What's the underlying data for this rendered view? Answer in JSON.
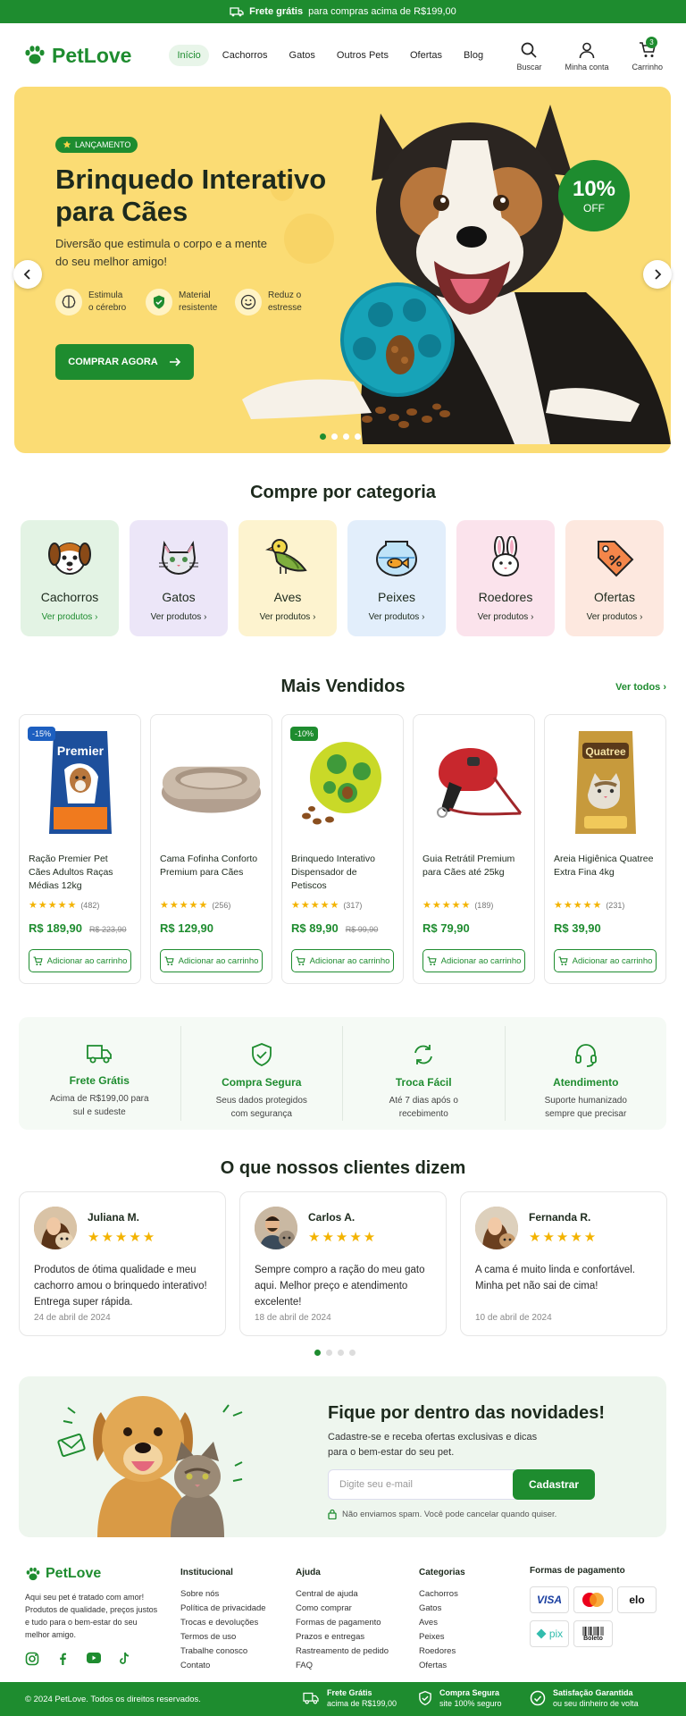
{
  "topbar": {
    "strong": "Frete grátis",
    "rest": "para compras acima de R$199,00"
  },
  "header": {
    "logo": "PetLove",
    "nav": [
      "Início",
      "Cachorros",
      "Gatos",
      "Outros Pets",
      "Ofertas",
      "Blog"
    ],
    "icons": {
      "search": "Buscar",
      "account": "Minha conta",
      "cart": "Carrinho",
      "cart_count": "3"
    }
  },
  "hero": {
    "badge": "LANÇAMENTO",
    "title": "Brinquedo Interativo para Cães",
    "subtitle": "Diversão que estimula o corpo e a mente do seu melhor amigo!",
    "features": [
      {
        "line1": "Estimula",
        "line2": "o cérebro",
        "icon": "brain-icon"
      },
      {
        "line1": "Material",
        "line2": "resistente",
        "icon": "shield-icon"
      },
      {
        "line1": "Reduz o",
        "line2": "estresse",
        "icon": "smile-icon"
      }
    ],
    "button": "COMPRAR AGORA",
    "discount_value": "10%",
    "discount_label": "OFF",
    "slides": 4,
    "active_slide": 1
  },
  "categories": {
    "title": "Compre por categoria",
    "items": [
      {
        "name": "Cachorros",
        "link": "Ver produtos ›",
        "bg": "#e3f3e4"
      },
      {
        "name": "Gatos",
        "link": "Ver produtos ›",
        "bg": "#ece6f8"
      },
      {
        "name": "Aves",
        "link": "Ver produtos ›",
        "bg": "#fdf3cf"
      },
      {
        "name": "Peixes",
        "link": "Ver produtos ›",
        "bg": "#e2eefb"
      },
      {
        "name": "Roedores",
        "link": "Ver produtos ›",
        "bg": "#fbe3ec"
      },
      {
        "name": "Ofertas",
        "link": "Ver produtos ›",
        "bg": "#fde8df"
      }
    ]
  },
  "bestsellers": {
    "title": "Mais Vendidos",
    "see_all": "Ver todos ›",
    "products": [
      {
        "name": "Ração Premier Pet Cães Adultos Raças Médias 12kg",
        "rating": 4.5,
        "reviews": "(482)",
        "price": "R$ 189,90",
        "old_price": "R$ 223,90",
        "tag": "-15%",
        "button": "Adicionar ao carrinho"
      },
      {
        "name": "Cama Fofinha Conforto Premium para Cães",
        "rating": 4.5,
        "reviews": "(256)",
        "price": "R$ 129,90",
        "old_price": "",
        "tag": "",
        "button": "Adicionar ao carrinho"
      },
      {
        "name": "Brinquedo Interativo Dispensador de Petiscos",
        "rating": 4.5,
        "reviews": "(317)",
        "price": "R$ 89,90",
        "old_price": "R$ 99,90",
        "tag": "-10%",
        "button": "Adicionar ao carrinho"
      },
      {
        "name": "Guia Retrátil Premium para Cães até 25kg",
        "rating": 4.5,
        "reviews": "(189)",
        "price": "R$ 79,90",
        "old_price": "",
        "tag": "",
        "button": "Adicionar ao carrinho"
      },
      {
        "name": "Areia Higiênica Quatree Extra Fina 4kg",
        "rating": 4.5,
        "reviews": "(231)",
        "price": "R$ 39,90",
        "old_price": "",
        "tag": "",
        "button": "Adicionar ao carrinho"
      }
    ],
    "package_texts": {
      "premier": "Premier",
      "quatree": "Quatree"
    }
  },
  "benefits": [
    {
      "title": "Frete Grátis",
      "desc": "Acima de R$199,00 para sul e sudeste",
      "icon": "truck-icon"
    },
    {
      "title": "Compra Segura",
      "desc": "Seus dados protegidos com segurança",
      "icon": "shield-check-icon"
    },
    {
      "title": "Troca Fácil",
      "desc": "Até 7 dias após o recebimento",
      "icon": "refresh-icon"
    },
    {
      "title": "Atendimento",
      "desc": "Suporte humanizado sempre que precisar",
      "icon": "headset-icon"
    }
  ],
  "testimonials": {
    "title": "O que nossos clientes dizem",
    "items": [
      {
        "name": "Juliana M.",
        "stars": 5,
        "text": "Produtos de ótima qualidade e meu cachorro amou o brinquedo interativo! Entrega super rápida.",
        "date": "24 de abril de 2024"
      },
      {
        "name": "Carlos A.",
        "stars": 5,
        "text": "Sempre compro a ração do meu gato aqui. Melhor preço e atendimento excelente!",
        "date": "18 de abril de 2024"
      },
      {
        "name": "Fernanda R.",
        "stars": 5,
        "text": "A cama é muito linda e confortável. Minha pet não sai de cima!",
        "date": "10 de abril de 2024"
      }
    ]
  },
  "newsletter": {
    "title": "Fique por dentro das novidades!",
    "subtitle": "Cadastre-se e receba ofertas exclusivas e dicas para o bem-estar do seu pet.",
    "placeholder": "Digite seu e-mail",
    "button": "Cadastrar",
    "note": "Não enviamos spam. Você pode cancelar quando quiser."
  },
  "footer": {
    "brand": "PetLove",
    "about": "Aqui seu pet é tratado com amor! Produtos de qualidade, preços justos e tudo para o bem-estar do seu melhor amigo.",
    "columns": [
      {
        "title": "Institucional",
        "links": [
          "Sobre nós",
          "Política de privacidade",
          "Trocas e devoluções",
          "Termos de uso",
          "Trabalhe conosco",
          "Contato"
        ]
      },
      {
        "title": "Ajuda",
        "links": [
          "Central de ajuda",
          "Como comprar",
          "Formas de pagamento",
          "Prazos e entregas",
          "Rastreamento de pedido",
          "FAQ"
        ]
      },
      {
        "title": "Categorias",
        "links": [
          "Cachorros",
          "Gatos",
          "Aves",
          "Peixes",
          "Roedores",
          "Ofertas"
        ]
      }
    ],
    "payments_title": "Formas de pagamento",
    "payments": [
      "VISA",
      "",
      "elo",
      "pix",
      "Boleto",
      ""
    ]
  },
  "bottombar": {
    "copyright": "© 2024 PetLove. Todos os direitos reservados.",
    "items": [
      {
        "title": "Frete Grátis",
        "sub": "acima de R$199,00"
      },
      {
        "title": "Compra Segura",
        "sub": "site 100% seguro"
      },
      {
        "title": "Satisfação Garantida",
        "sub": "ou seu dinheiro de volta"
      }
    ]
  }
}
